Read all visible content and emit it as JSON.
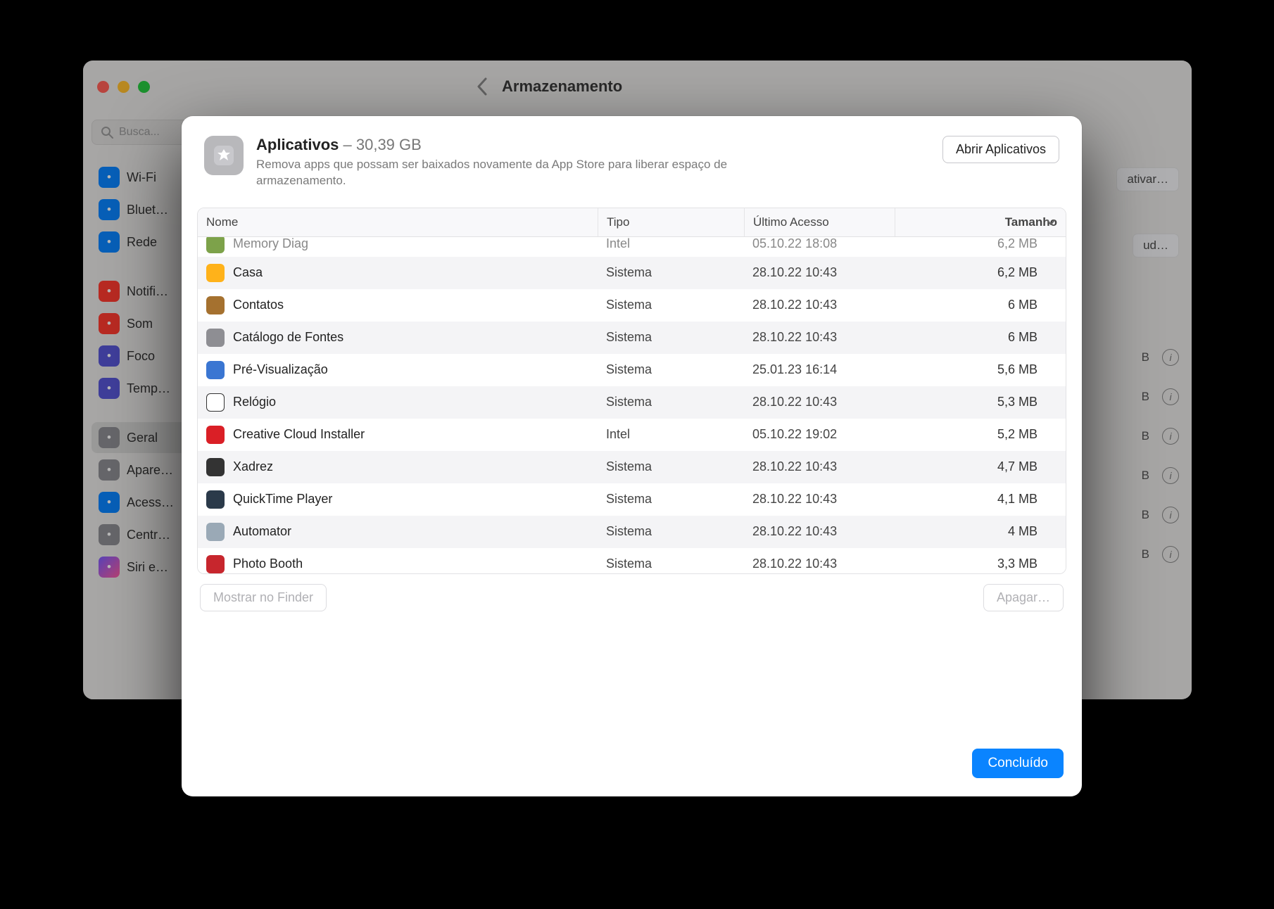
{
  "window": {
    "title": "Armazenamento",
    "search_placeholder": "Busca..."
  },
  "sidebar": {
    "items": [
      {
        "icon": "wifi",
        "label": "Wi-Fi",
        "color": "bg-blue"
      },
      {
        "icon": "bluetooth",
        "label": "Bluet…",
        "color": "bg-blue"
      },
      {
        "icon": "globe",
        "label": "Rede",
        "color": "bg-blue"
      },
      {
        "icon": "bell",
        "label": "Notifi…",
        "color": "bg-red"
      },
      {
        "icon": "sound",
        "label": "Som",
        "color": "bg-red"
      },
      {
        "icon": "moon",
        "label": "Foco",
        "color": "bg-indigo"
      },
      {
        "icon": "hourglass",
        "label": "Temp…",
        "color": "bg-indigo"
      },
      {
        "icon": "gear",
        "label": "Geral",
        "color": "bg-gray",
        "selected": true
      },
      {
        "icon": "contrast",
        "label": "Apare…",
        "color": "bg-gray"
      },
      {
        "icon": "access",
        "label": "Acess…",
        "color": "bg-blue"
      },
      {
        "icon": "control",
        "label": "Centr…",
        "color": "bg-gray"
      },
      {
        "icon": "siri",
        "label": "Siri e…",
        "color": ""
      }
    ]
  },
  "right_buttons": {
    "b1": "ativar…",
    "b2": "ud…"
  },
  "right_strips": [
    {
      "size": "B"
    },
    {
      "size": "B"
    },
    {
      "size": "B"
    },
    {
      "size": "B"
    },
    {
      "size": "B"
    },
    {
      "size": "B"
    }
  ],
  "sheet": {
    "title": "Aplicativos",
    "size": "30,39 GB",
    "subtitle": "Remova apps que possam ser baixados novamente da App Store para liberar espaço de armazenamento.",
    "open": "Abrir Aplicativos",
    "columns": {
      "name": "Nome",
      "type": "Tipo",
      "date": "Último Acesso",
      "size": "Tamanho"
    },
    "rows": [
      {
        "cut": true,
        "name": "Memory Diag",
        "type": "Intel",
        "date": "05.10.22 18:08",
        "size": "6,2 MB",
        "badge": "#7da24a"
      },
      {
        "name": "Casa",
        "type": "Sistema",
        "date": "28.10.22 10:43",
        "size": "6,2 MB",
        "badge": "#ffb21a"
      },
      {
        "name": "Contatos",
        "type": "Sistema",
        "date": "28.10.22 10:43",
        "size": "6 MB",
        "badge": "#a5712f"
      },
      {
        "name": "Catálogo de Fontes",
        "type": "Sistema",
        "date": "28.10.22 10:43",
        "size": "6 MB",
        "badge": "#8e8e93"
      },
      {
        "name": "Pré-Visualização",
        "type": "Sistema",
        "date": "25.01.23 16:14",
        "size": "5,6 MB",
        "badge": "#3a76d2"
      },
      {
        "name": "Relógio",
        "type": "Sistema",
        "date": "28.10.22 10:43",
        "size": "5,3 MB",
        "badge": "#ffffff",
        "ring": true
      },
      {
        "name": "Creative Cloud Installer",
        "type": "Intel",
        "date": "05.10.22 19:02",
        "size": "5,2 MB",
        "badge": "#da1f26"
      },
      {
        "name": "Xadrez",
        "type": "Sistema",
        "date": "28.10.22 10:43",
        "size": "4,7 MB",
        "badge": "#333333"
      },
      {
        "name": "QuickTime Player",
        "type": "Sistema",
        "date": "28.10.22 10:43",
        "size": "4,1 MB",
        "badge": "#2b3a4a"
      },
      {
        "name": "Automator",
        "type": "Sistema",
        "date": "28.10.22 10:43",
        "size": "4 MB",
        "badge": "#9aa9b6"
      },
      {
        "name": "Photo Booth",
        "type": "Sistema",
        "date": "28.10.22 10:43",
        "size": "3,3 MB",
        "badge": "#c7262d"
      }
    ],
    "show_in_finder": "Mostrar no Finder",
    "delete": "Apagar…",
    "done": "Concluído"
  }
}
